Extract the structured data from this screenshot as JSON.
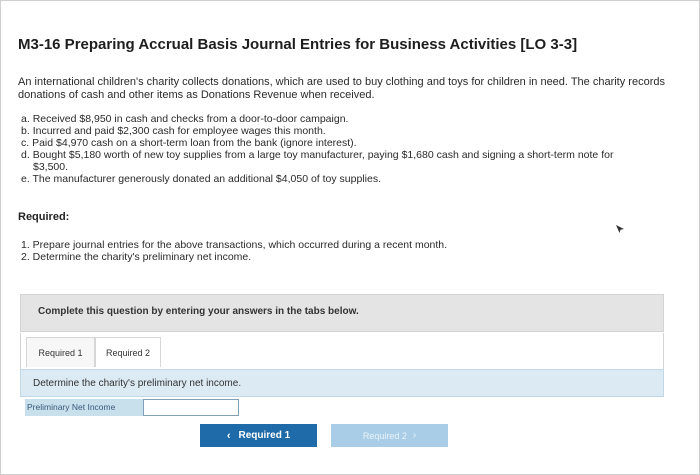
{
  "problem": {
    "title": "M3-16 Preparing Accrual Basis Journal Entries for Business Activities [LO 3-3]",
    "intro": "An international children's charity collects donations, which are used to buy clothing and toys for children in need. The charity records donations of cash and other items as Donations Revenue when received.",
    "items": [
      {
        "letter": "a.",
        "text": "Received $8,950 in cash and checks from a door-to-door campaign."
      },
      {
        "letter": "b.",
        "text": "Incurred and paid $2,300 cash for employee wages this month."
      },
      {
        "letter": "c.",
        "text": "Paid $4,970 cash on a short-term loan from the bank (ignore interest)."
      },
      {
        "letter": "d.",
        "text": "Bought $5,180 worth of new toy supplies from a large toy manufacturer, paying $1,680 cash and signing a short-term note for",
        "cont": "$3,500."
      },
      {
        "letter": "e.",
        "text": "The manufacturer generously donated an additional $4,050 of toy supplies."
      }
    ],
    "required_heading": "Required:",
    "required_items": [
      "1. Prepare journal entries for the above transactions, which occurred during a recent month.",
      "2. Determine the charity's preliminary net income."
    ]
  },
  "question": {
    "instructions": "Complete this question by entering your answers in the tabs below.",
    "tabs": [
      {
        "label": "Required 1"
      },
      {
        "label": "Required 2"
      }
    ],
    "prompt": "Determine the charity's preliminary net income.",
    "net_income": {
      "label": "Preliminary Net Income",
      "value": ""
    }
  },
  "navigation": {
    "prev_label": "Required 1",
    "next_label": "Required 2",
    "prev_icon": "chevron-left-icon",
    "next_icon": "chevron-right-icon"
  },
  "colors": {
    "primary_button": "#1f6aa8",
    "disabled_button": "#a9cde6",
    "prompt_bg": "#dbeaf3",
    "instructions_bg": "#e4e4e4"
  }
}
